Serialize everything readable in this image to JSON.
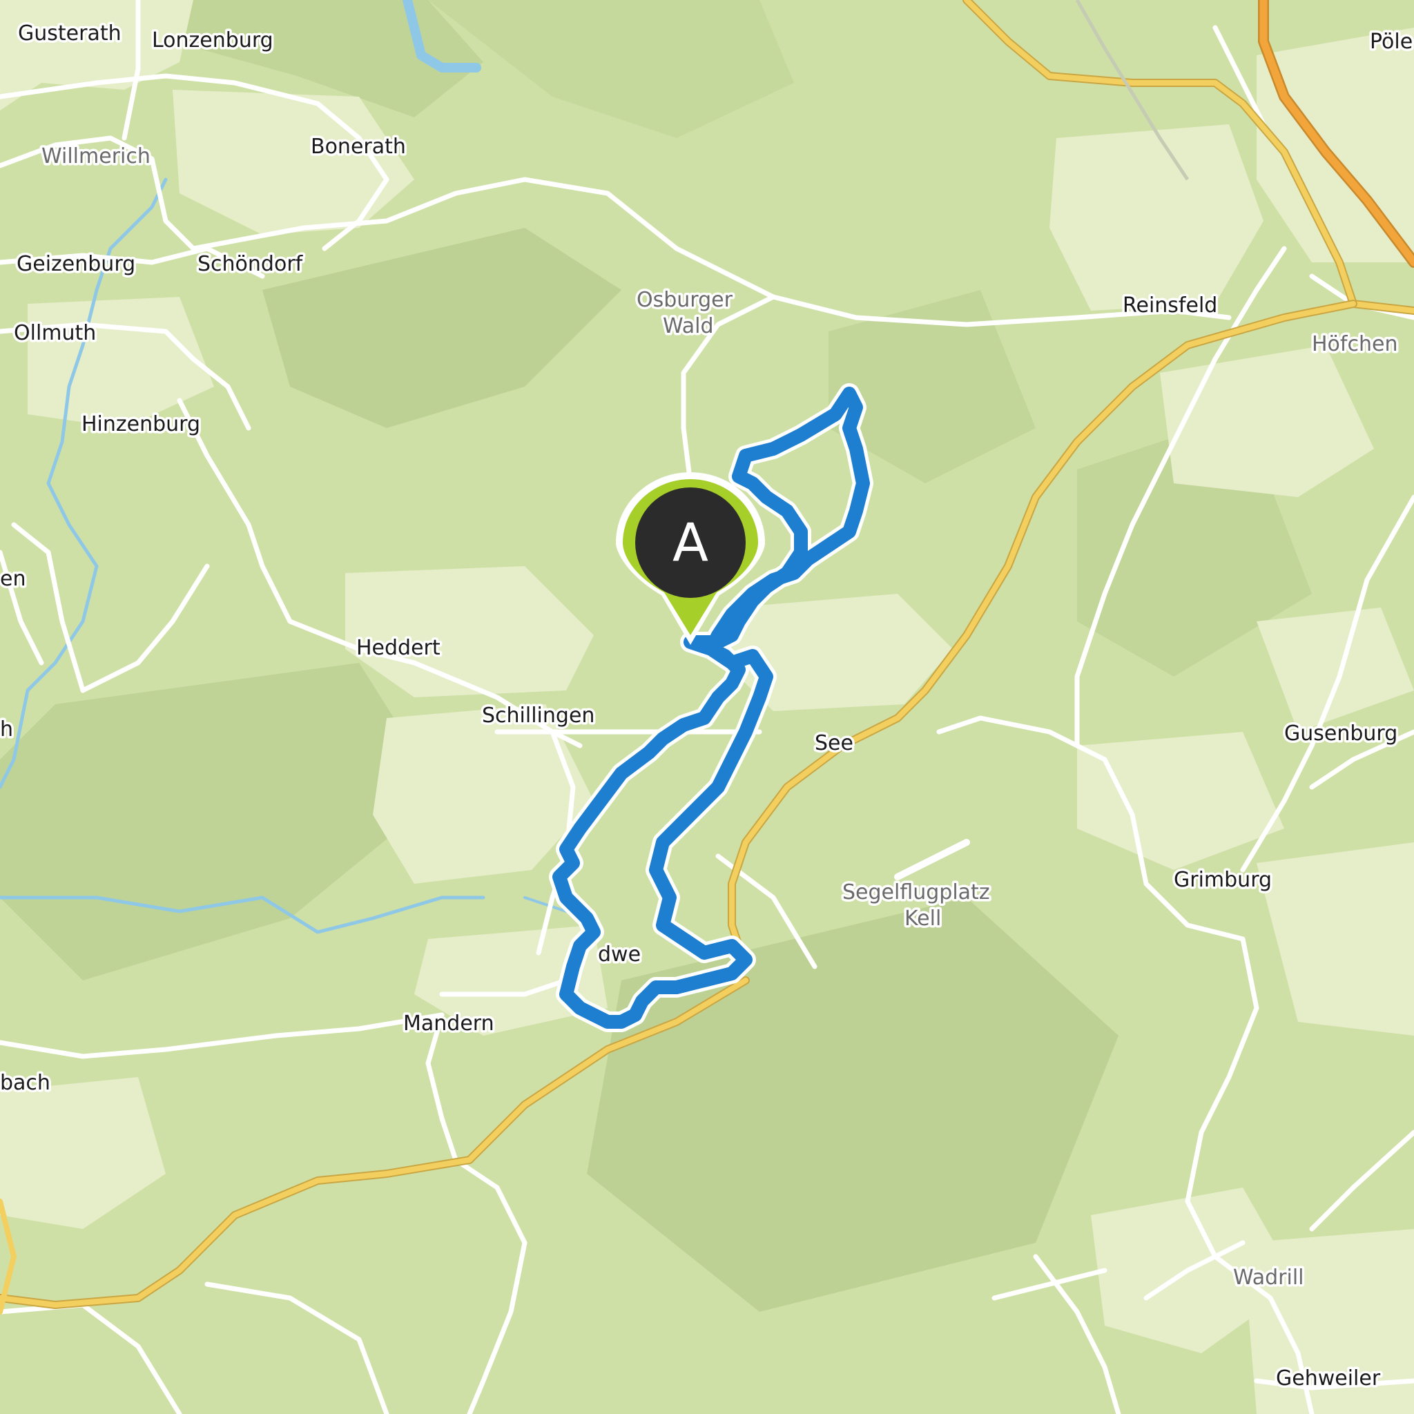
{
  "map": {
    "type": "topographic route map",
    "colors": {
      "forest": "#cfe0a6",
      "open_land": "#e6edc9",
      "road": "#ffffff",
      "main_road": "#f3cf5f",
      "highway": "#f1a53a",
      "water": "#8ec8e6",
      "route": "#1e7fd0",
      "marker_fill": "#a7cf2a",
      "marker_center": "#2b2b2b"
    },
    "start_marker": {
      "label": "A",
      "icon": "map-pin-icon"
    },
    "place_labels": [
      {
        "id": "gusterath",
        "text": "Gusterath"
      },
      {
        "id": "lonzenburg",
        "text": "Lonzenburg"
      },
      {
        "id": "pole",
        "text": "Pöle"
      },
      {
        "id": "willmerich",
        "text": "Willmerich"
      },
      {
        "id": "bonerath",
        "text": "Bonerath"
      },
      {
        "id": "geizenburg",
        "text": "Geizenburg"
      },
      {
        "id": "schondorf",
        "text": "Schöndorf"
      },
      {
        "id": "osburger-wald-1",
        "text": "Osburger"
      },
      {
        "id": "osburger-wald-2",
        "text": "Wald"
      },
      {
        "id": "reinsfeld",
        "text": "Reinsfeld"
      },
      {
        "id": "ollmuth",
        "text": "Ollmuth"
      },
      {
        "id": "hofchen",
        "text": "Höfchen"
      },
      {
        "id": "hinzenburg",
        "text": "Hinzenburg"
      },
      {
        "id": "en",
        "text": "en"
      },
      {
        "id": "heddert",
        "text": "Heddert"
      },
      {
        "id": "schillingen",
        "text": "Schillingen"
      },
      {
        "id": "see",
        "text": "See"
      },
      {
        "id": "gusenburg",
        "text": "Gusenburg"
      },
      {
        "id": "h",
        "text": "h"
      },
      {
        "id": "grimburg",
        "text": "Grimburg"
      },
      {
        "id": "segelflugplatz-1",
        "text": "Segelflugplatz"
      },
      {
        "id": "segelflugplatz-2",
        "text": "Kell"
      },
      {
        "id": "dwe",
        "text": "dwe"
      },
      {
        "id": "mandern",
        "text": "Mandern"
      },
      {
        "id": "bach",
        "text": "bach"
      },
      {
        "id": "wadrill",
        "text": "Wadrill"
      },
      {
        "id": "gehweiler",
        "text": "Gehweiler"
      }
    ]
  }
}
